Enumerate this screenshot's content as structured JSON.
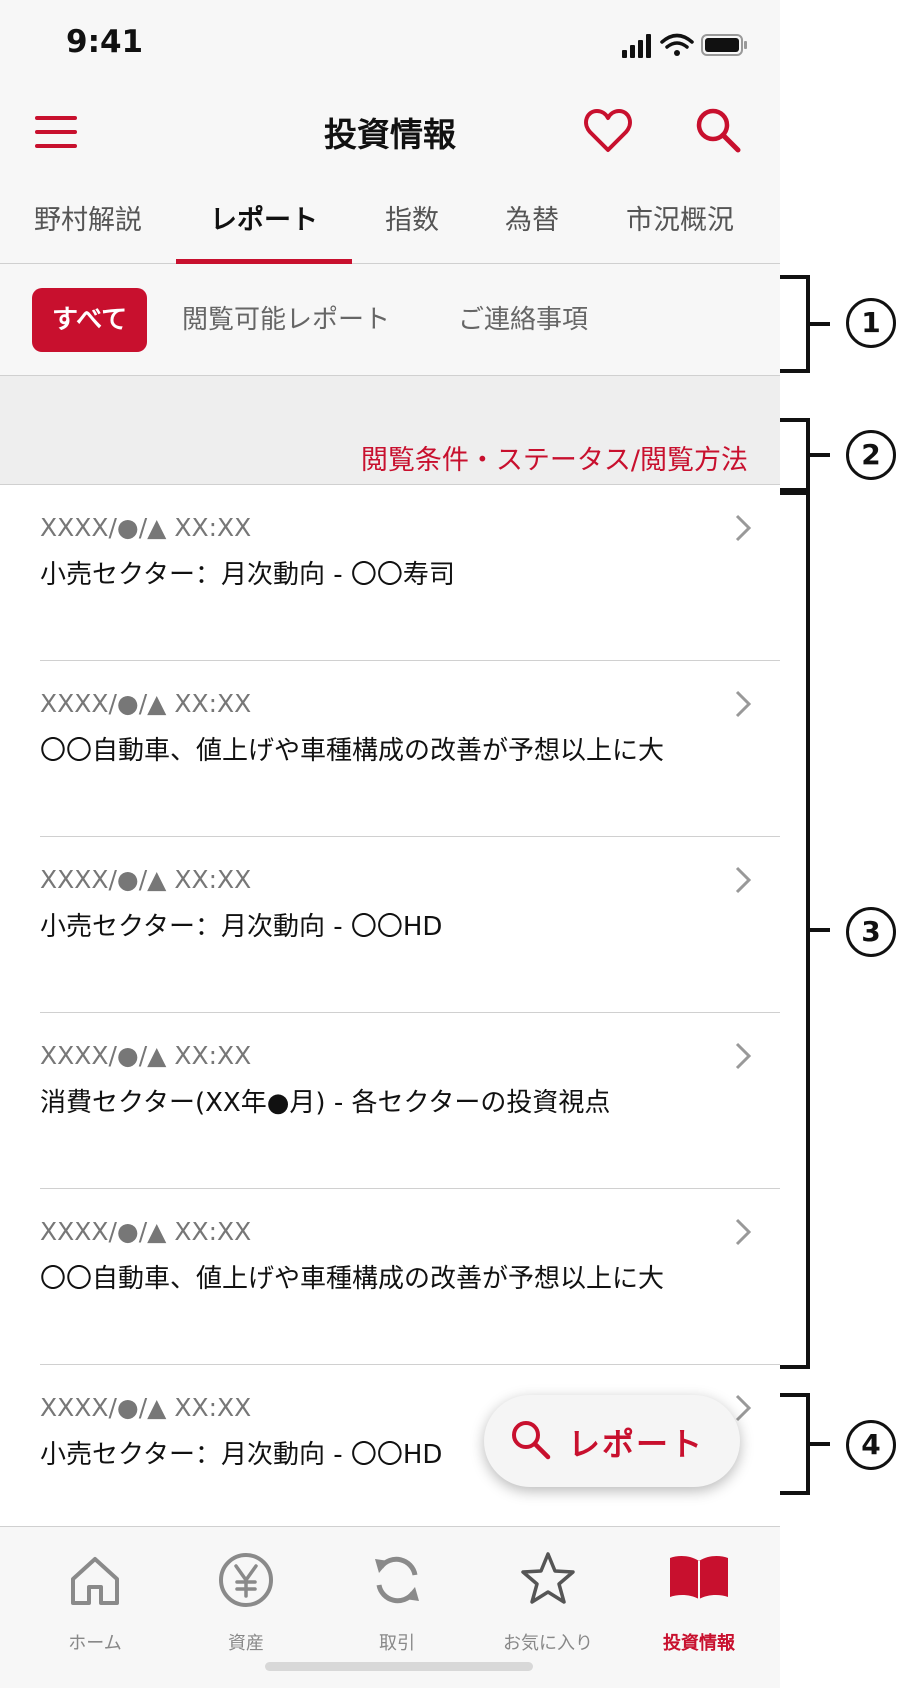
{
  "status_bar": {
    "time": "9:41"
  },
  "header": {
    "title": "投資情報",
    "icons": [
      "menu-icon",
      "heart-icon",
      "search-icon"
    ]
  },
  "tabs": [
    {
      "label": "野村解説",
      "active": false
    },
    {
      "label": "レポート",
      "active": true
    },
    {
      "label": "指数",
      "active": false
    },
    {
      "label": "為替",
      "active": false
    },
    {
      "label": "市況概況",
      "active": false
    }
  ],
  "filters": [
    {
      "label": "すべて",
      "active": true
    },
    {
      "label": "閲覧可能レポート",
      "active": false
    },
    {
      "label": "ご連絡事項",
      "active": false
    }
  ],
  "condition_link": "閲覧条件・ステータス/閲覧方法",
  "reports": [
    {
      "date": "XXXX/●/▲ XX:XX",
      "title": "小売セクター：月次動向 - 〇〇寿司"
    },
    {
      "date": "XXXX/●/▲ XX:XX",
      "title": "〇〇自動車、値上げや車種構成の改善が予想以上に大"
    },
    {
      "date": "XXXX/●/▲ XX:XX",
      "title": "小売セクター：月次動向 - 〇〇HD"
    },
    {
      "date": "XXXX/●/▲ XX:XX",
      "title": "消費セクター(XX年●月) - 各セクターの投資視点"
    },
    {
      "date": "XXXX/●/▲ XX:XX",
      "title": "〇〇自動車、値上げや車種構成の改善が予想以上に大"
    },
    {
      "date": "XXXX/●/▲ XX:XX",
      "title": "小売セクター：月次動向 - 〇〇HD"
    }
  ],
  "fab": {
    "label": "レポート",
    "icon": "search-icon"
  },
  "bottom_nav": [
    {
      "label": "ホーム",
      "icon": "home-icon",
      "active": false
    },
    {
      "label": "資産",
      "icon": "yen-icon",
      "active": false
    },
    {
      "label": "取引",
      "icon": "refresh-icon",
      "active": false
    },
    {
      "label": "お気に入り",
      "icon": "star-icon",
      "active": false
    },
    {
      "label": "投資情報",
      "icon": "book-icon",
      "active": true
    }
  ],
  "annotations": [
    "1",
    "2",
    "3",
    "4"
  ],
  "colors": {
    "accent": "#c8102e",
    "background": "#f7f7f7",
    "text": "#111111",
    "muted": "#777777"
  }
}
